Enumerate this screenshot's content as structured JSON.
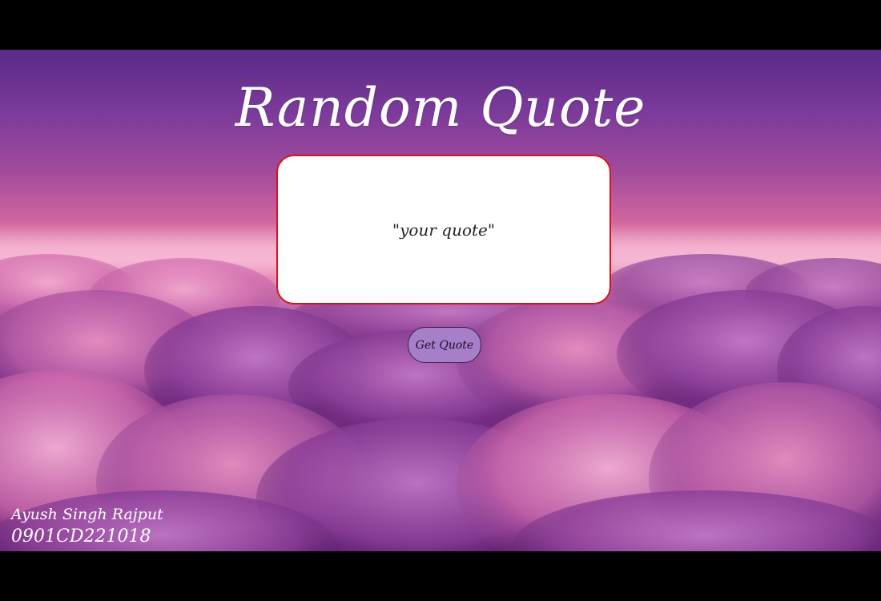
{
  "page": {
    "title": "Random Quote",
    "background_colors": {
      "sky_top": "#5a2a86",
      "horizon": "#f2a2c4",
      "clouds": "#7a2e86"
    }
  },
  "quote_box": {
    "text": "\"your quote\"",
    "border_color": "#e0101a",
    "background_color": "#ffffff"
  },
  "button": {
    "label": "Get Quote",
    "background_color": "#a77fc9"
  },
  "footer": {
    "name": "Ayush Singh Rajput",
    "id": "0901CD221018"
  }
}
